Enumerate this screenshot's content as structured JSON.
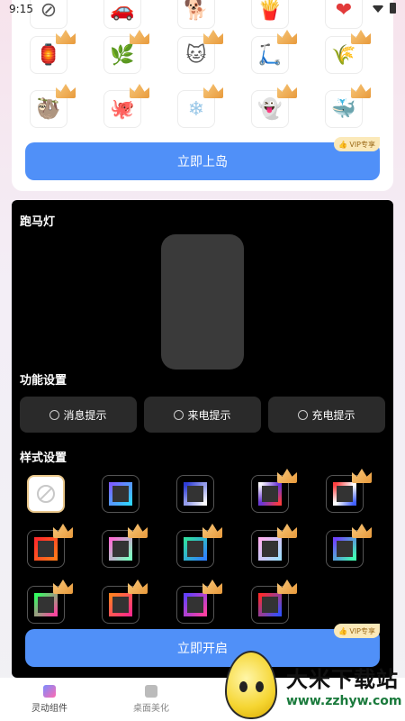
{
  "status": {
    "time": "9:15"
  },
  "top_card": {
    "icons_row0": [
      "⊘",
      "🚗",
      "🐕",
      "🍟",
      "❤"
    ],
    "icons_row1": [
      "🏮",
      "🌿",
      "🐱",
      "🛴",
      "🌾"
    ],
    "icons_row2": [
      "🦥",
      "🐙",
      "❄",
      "👻",
      "🐳"
    ],
    "vip_label": "VIP专享",
    "button_label": "立即上岛"
  },
  "marquee": {
    "title": "跑马灯",
    "func_title": "功能设置",
    "func_options": [
      "消息提示",
      "来电提示",
      "充电提示"
    ],
    "style_title": "样式设置",
    "style_frames": [
      [
        "none",
        "#7c5cff|#2fd6ff",
        "#2b3ad6|#ffffff",
        "#ffffff|#6a36d6|#ff3b3b",
        "#ff3b3b|#ffffff|#3b5bff"
      ],
      [
        "#ff2a2a|#ff7a1a",
        "#ff6ad5|#7affc0",
        "#30e0a0|#3080ff",
        "#ffb0f0|#a0e0ff",
        "#7040ff|#40ffb0"
      ],
      [
        "#30ff60|#ff40a0",
        "#ff8020|#ff2a8a",
        "#6040ff|#ff40a0",
        "#ff2a2a|#3050ff"
      ]
    ],
    "vip_label": "VIP专享",
    "button_label": "立即开启"
  },
  "nav": {
    "items": [
      "灵动组件",
      "桌面美化"
    ]
  },
  "watermark": {
    "title": "大米下载站",
    "url": "www.zzhyw.com"
  },
  "colors": {
    "primary": "#5090f8",
    "vip_bg": "#fbe9b9"
  }
}
